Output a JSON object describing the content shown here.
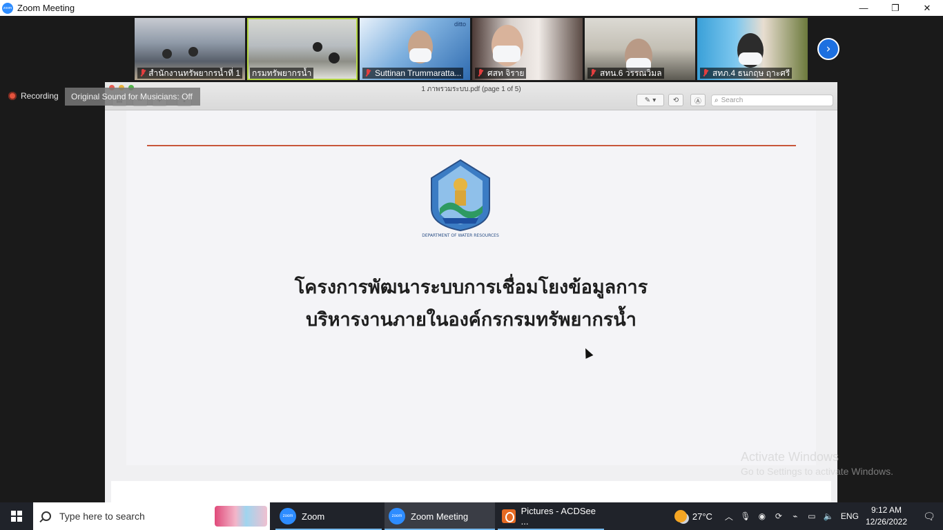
{
  "window": {
    "title": "Zoom Meeting",
    "logo_text": "zoom",
    "controls": {
      "minimize": "—",
      "restore": "❐",
      "close": "✕"
    }
  },
  "participants": [
    {
      "name": "สำนักงานทรัพยากรน้ำที่ 1",
      "muted": true,
      "active": false
    },
    {
      "name": "กรมทรัพยากรน้ำ",
      "muted": false,
      "active": true
    },
    {
      "name": "Suttinan Trummaratta...",
      "muted": true,
      "active": false,
      "badge": "ditto"
    },
    {
      "name": "ศสท จิราย",
      "muted": true,
      "active": false
    },
    {
      "name": "สทน.6 วรรณวิมล",
      "muted": true,
      "active": false
    },
    {
      "name": "สทภ.4 ธนกฤษ ฤาะศรี",
      "muted": true,
      "active": false
    }
  ],
  "next_page_icon": "›",
  "recording": {
    "label": "Recording"
  },
  "original_sound": {
    "label": "Original Sound for Musicians: Off"
  },
  "viewer": {
    "title": "1 ภาพรวมระบบ.pdf (page 1 of 5)",
    "search_placeholder": "Search",
    "page": {
      "emblem_caption": "DEPARTMENT OF WATER RESOURCES",
      "heading_line1": "โครงการพัฒนาระบบการเชื่อมโยงข้อมูลการ",
      "heading_line2": "บริหารงานภายในองค์กรกรมทรัพยากรน้ำ"
    }
  },
  "watermark": {
    "line1": "Activate Windows",
    "line2": "Go to Settings to activate Windows."
  },
  "taskbar": {
    "search_placeholder": "Type here to search",
    "items": [
      {
        "label": "Zoom",
        "icon": "zoom-icon"
      },
      {
        "label": "Zoom Meeting",
        "icon": "zoom-icon"
      },
      {
        "label": "Pictures - ACDSee ...",
        "icon": "acdsee-icon"
      }
    ],
    "weather": "27°C",
    "language": "ENG",
    "time": "9:12 AM",
    "date": "12/26/2022"
  },
  "colors": {
    "accent": "#2d8cff",
    "active_border": "#b5d843",
    "rule": "#c8563a",
    "record": "#e5533d"
  }
}
